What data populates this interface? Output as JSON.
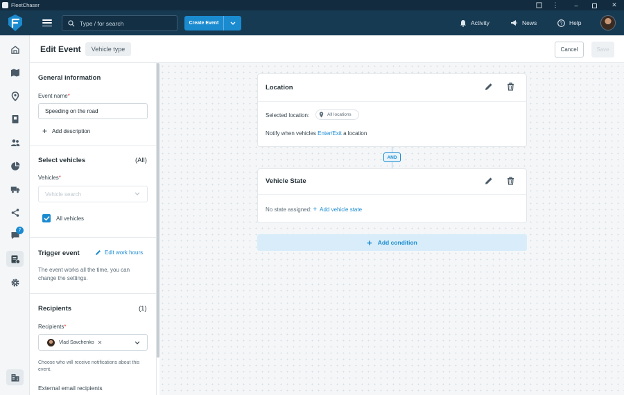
{
  "window": {
    "title": "FleetChaser"
  },
  "header": {
    "search_placeholder": "Type / for search",
    "create_event_label": "Create Event",
    "nav": {
      "activity": "Activity",
      "news": "News",
      "help": "Help"
    }
  },
  "rail": {
    "chat_badge": "7"
  },
  "page": {
    "title": "Edit Event",
    "type_chip": "Vehicle type",
    "cancel_label": "Cancel",
    "save_label": "Save"
  },
  "general": {
    "heading": "General information",
    "event_name_label": "Event name",
    "event_name_value": "Speeding on the road",
    "add_description": "Add description"
  },
  "vehicles": {
    "heading": "Select vehicles",
    "count": "(All)",
    "field_label": "Vehicles",
    "placeholder": "Vehicle search",
    "all_vehicles_label": "All vehicles",
    "all_vehicles_checked": true
  },
  "trigger": {
    "heading": "Trigger event",
    "edit_hours": "Edit work hours",
    "description": "The event works all the time, you can change the settings."
  },
  "recipients": {
    "heading": "Recipients",
    "count": "(1)",
    "field_label": "Recipients",
    "selected": "Vlad Savchenko",
    "hint": "Choose who will receive notifications about this event.",
    "external_label": "External email recipients"
  },
  "conditions": {
    "location": {
      "title": "Location",
      "selected_label": "Selected location:",
      "selected_value": "All locations",
      "notify_prefix": "Notify when vehicles",
      "notify_link": "Enter/Exit",
      "notify_suffix": "a location"
    },
    "and_label": "AND",
    "vehicle_state": {
      "title": "Vehicle State",
      "empty_text": "No state assigned:",
      "add_label": "Add vehicle state"
    },
    "add_condition": "Add condition"
  },
  "colors": {
    "brand": "#1b8bd0",
    "header_bg": "#173a53",
    "titlebar_bg": "#122b3f"
  }
}
